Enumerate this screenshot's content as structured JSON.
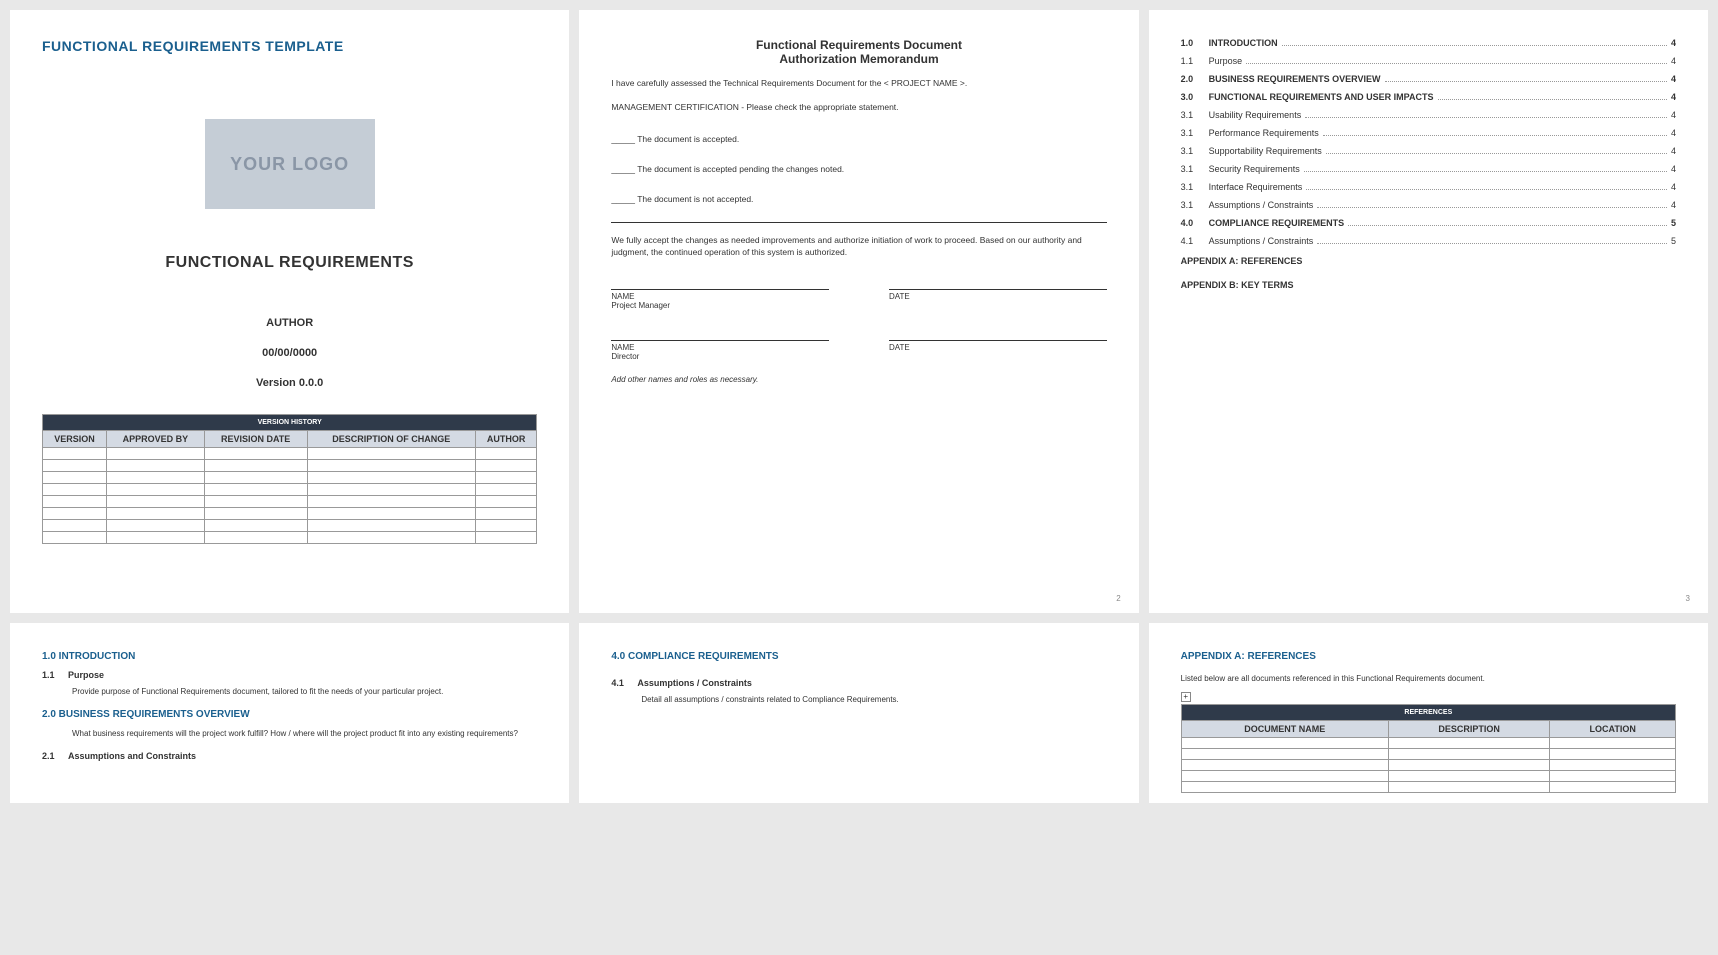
{
  "p1": {
    "title": "FUNCTIONAL REQUIREMENTS TEMPLATE",
    "logo": "YOUR LOGO",
    "heading": "FUNCTIONAL REQUIREMENTS",
    "author": "AUTHOR",
    "date": "00/00/0000",
    "version": "Version 0.0.0",
    "vh_header": "VERSION HISTORY",
    "vh_cols": [
      "VERSION",
      "APPROVED BY",
      "REVISION DATE",
      "DESCRIPTION OF CHANGE",
      "AUTHOR"
    ]
  },
  "p2": {
    "title1": "Functional Requirements Document",
    "title2": "Authorization Memorandum",
    "intro": "I have carefully assessed the Technical Requirements Document for the < PROJECT NAME >.",
    "cert": "MANAGEMENT CERTIFICATION - Please check the appropriate statement.",
    "opt1": "The document is accepted.",
    "opt2": "The document is accepted pending the changes noted.",
    "opt3": "The document is not accepted.",
    "accept": "We fully accept the changes as needed improvements and authorize initiation of work to proceed. Based on our authority and judgment, the continued operation of this system is authorized.",
    "name": "NAME",
    "date": "DATE",
    "role1": "Project Manager",
    "role2": "Director",
    "note": "Add other names and roles as necessary.",
    "pnum": "2"
  },
  "p3": {
    "toc": [
      {
        "n": "1.0",
        "t": "INTRODUCTION",
        "p": "4",
        "b": true
      },
      {
        "n": "1.1",
        "t": "Purpose",
        "p": "4",
        "b": false
      },
      {
        "n": "2.0",
        "t": "BUSINESS REQUIREMENTS OVERVIEW",
        "p": "4",
        "b": true
      },
      {
        "n": "3.0",
        "t": "FUNCTIONAL REQUIREMENTS AND USER IMPACTS",
        "p": "4",
        "b": true
      },
      {
        "n": "3.1",
        "t": "Usability Requirements",
        "p": "4",
        "b": false
      },
      {
        "n": "3.1",
        "t": "Performance Requirements",
        "p": "4",
        "b": false
      },
      {
        "n": "3.1",
        "t": "Supportability Requirements",
        "p": "4",
        "b": false
      },
      {
        "n": "3.1",
        "t": "Security Requirements",
        "p": "4",
        "b": false
      },
      {
        "n": "3.1",
        "t": "Interface Requirements",
        "p": "4",
        "b": false
      },
      {
        "n": "3.1",
        "t": "Assumptions / Constraints",
        "p": "4",
        "b": false
      },
      {
        "n": "4.0",
        "t": "COMPLIANCE REQUIREMENTS",
        "p": "5",
        "b": true
      },
      {
        "n": "4.1",
        "t": "Assumptions / Constraints",
        "p": "5",
        "b": false
      }
    ],
    "appA": "APPENDIX A: REFERENCES",
    "appB": "APPENDIX B: KEY TERMS",
    "pnum": "3"
  },
  "p4": {
    "s1": "1.0  INTRODUCTION",
    "s1_1n": "1.1",
    "s1_1t": "Purpose",
    "s1_1b": "Provide purpose of Functional Requirements document, tailored to fit the needs of your particular project.",
    "s2": "2.0  BUSINESS REQUIREMENTS OVERVIEW",
    "s2b": "What business requirements will the project work fulfill?  How / where will the project product fit into any existing requirements?",
    "s2_1n": "2.1",
    "s2_1t": "Assumptions and Constraints"
  },
  "p5": {
    "s4": "4.0  COMPLIANCE REQUIREMENTS",
    "s4_1n": "4.1",
    "s4_1t": "Assumptions / Constraints",
    "s4_1b": "Detail all assumptions / constraints related to Compliance Requirements."
  },
  "p6": {
    "title": "APPENDIX A: REFERENCES",
    "note": "Listed below are all documents referenced in this Functional Requirements document.",
    "ref_header": "REFERENCES",
    "ref_cols": [
      "DOCUMENT NAME",
      "DESCRIPTION",
      "LOCATION"
    ]
  }
}
